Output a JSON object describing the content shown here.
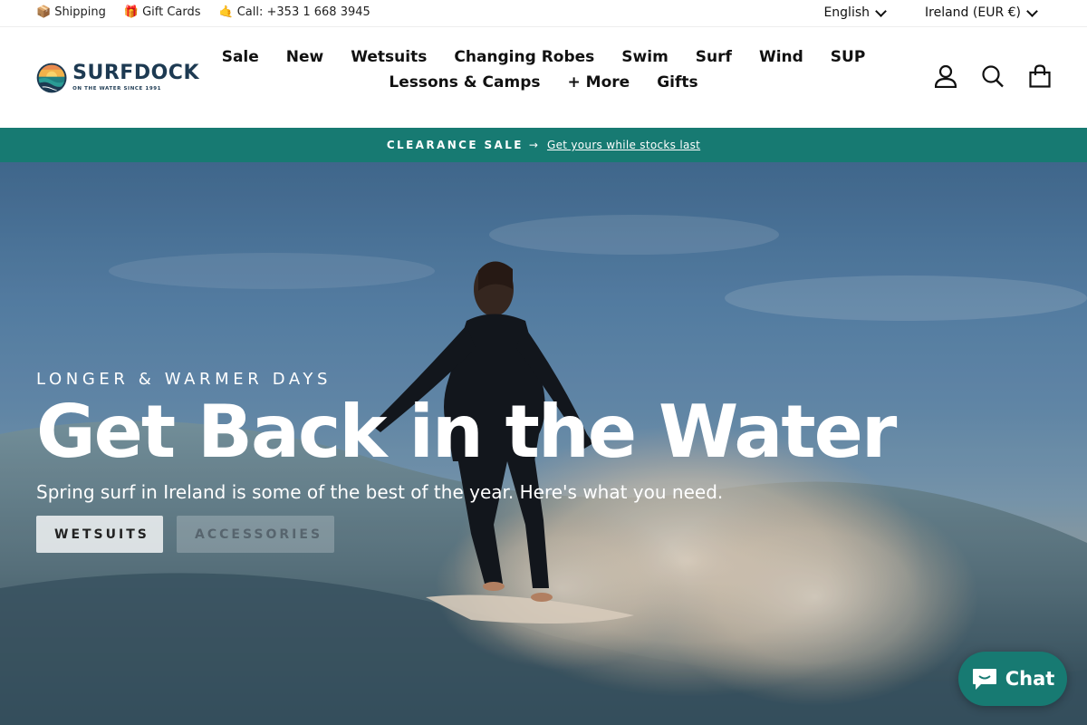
{
  "utility": {
    "links": [
      {
        "icon": "package-icon",
        "glyph": "📦",
        "label": "Shipping"
      },
      {
        "icon": "gift-icon",
        "glyph": "🎁",
        "label": "Gift Cards"
      },
      {
        "icon": "phone-hand-icon",
        "glyph": "🤙",
        "label": "Call: +353 1 668 3945"
      }
    ],
    "language": "English",
    "currency": "Ireland (EUR €)"
  },
  "logo": {
    "name": "SURFDOCK",
    "tagline": "ON THE WATER SINCE 1991"
  },
  "nav": {
    "row1": [
      "Sale",
      "New",
      "Wetsuits",
      "Changing Robes",
      "Swim",
      "Surf",
      "Wind",
      "SUP"
    ],
    "row2": [
      "Lessons & Camps",
      "+ More",
      "Gifts"
    ]
  },
  "header_icons": [
    "account-icon",
    "search-icon",
    "cart-icon"
  ],
  "announcement": {
    "label": "CLEARANCE SALE",
    "arrow": "→",
    "link": "Get yours while stocks last"
  },
  "hero": {
    "eyebrow": "LONGER & WARMER DAYS",
    "title": "Get Back in the Water",
    "subtitle": "Spring surf in Ireland is some of the best of the year. Here's what you need.",
    "buttons": [
      "WETSUITS",
      "ACCESSORIES"
    ]
  },
  "chat": {
    "label": "Chat"
  },
  "colors": {
    "accent": "#177a72",
    "brand_dark": "#1d3a52",
    "text": "#111111"
  }
}
